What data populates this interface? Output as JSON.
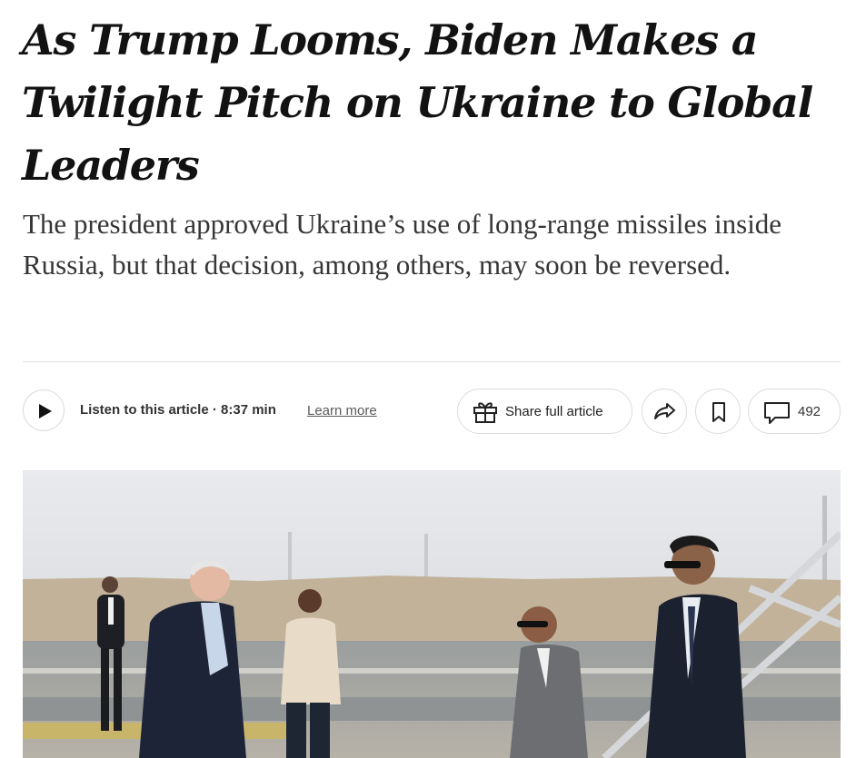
{
  "article": {
    "headline": "As Trump Looms, Biden Makes a Twilight Pitch on Ukraine to Global Leaders",
    "summary": "The president approved Ukraine’s use of long-range missiles inside Russia, but that decision, among others, may soon be reversed."
  },
  "toolbar": {
    "listen_label": "Listen to this article · 8:37 min",
    "learn_more": "Learn more",
    "share_full_label": "Share full article",
    "comment_count": "492",
    "icons": {
      "play": "play-icon",
      "gift": "gift-icon",
      "share": "share-arrow-icon",
      "save": "bookmark-icon",
      "comments": "comment-bubble-icon"
    }
  },
  "photo": {
    "subject": "lead-photo"
  },
  "colors": {
    "headline": "#121212",
    "summary": "#363636",
    "border": "#dcdcdc"
  }
}
